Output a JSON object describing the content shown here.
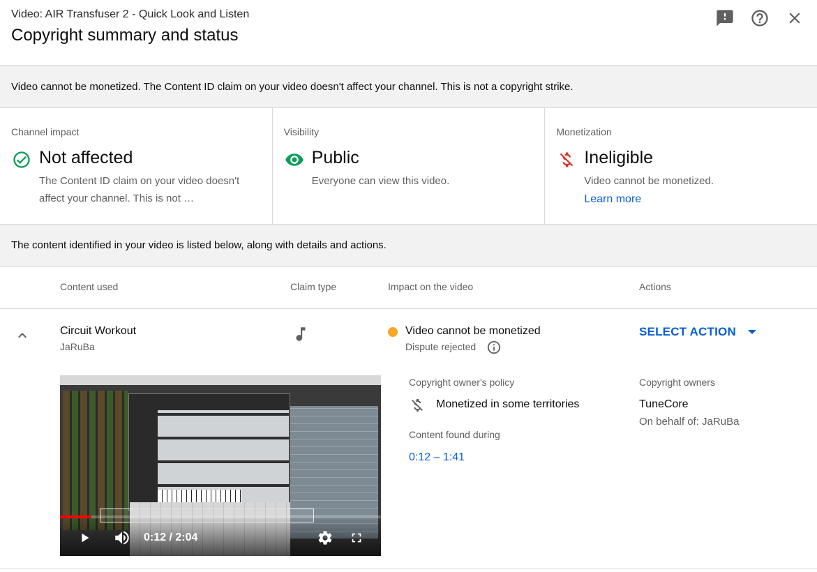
{
  "header": {
    "video_title": "Video: AIR Transfuser 2 - Quick Look and Listen",
    "page_title": "Copyright summary and status",
    "icons": [
      "feedback-icon",
      "help-icon",
      "close-icon"
    ]
  },
  "summary_banner": "Video cannot be monetized. The Content ID claim on your video doesn't affect your channel. This is not a copyright strike.",
  "cards": {
    "channel_impact": {
      "label": "Channel impact",
      "value": "Not affected",
      "description": "The Content ID claim on your video doesn't affect your channel. This is not …",
      "icon": "check-circle-icon",
      "color": "#0f9d58"
    },
    "visibility": {
      "label": "Visibility",
      "value": "Public",
      "description": "Everyone can view this video.",
      "icon": "eye-icon",
      "color": "#0f9d58"
    },
    "monetization": {
      "label": "Monetization",
      "value": "Ineligible",
      "description": "Video cannot be monetized.",
      "link": "Learn more",
      "icon": "no-money-icon",
      "color": "#d93025"
    }
  },
  "content_banner": "The content identified in your video is listed below, along with details and actions.",
  "table": {
    "headers": {
      "content_used": "Content used",
      "claim_type": "Claim type",
      "impact": "Impact on the video",
      "actions": "Actions"
    },
    "rows": [
      {
        "content_name": "Circuit Workout",
        "content_artist": "JaRuBa",
        "claim_type_icon": "music-note-icon",
        "impact": "Video cannot be monetized",
        "impact_status_color": "#f9a825",
        "dispute_status": "Dispute rejected",
        "action_label": "SELECT ACTION",
        "video": {
          "time": "0:12 / 2:04",
          "progress": 0.097
        },
        "policy_label": "Copyright owner's policy",
        "policy": "Monetized in some territories",
        "found_label": "Content found during",
        "found_range": "0:12 – 1:41",
        "owners_label": "Copyright owners",
        "owner": "TuneCore",
        "on_behalf": "On behalf of: JaRuBa"
      }
    ]
  }
}
